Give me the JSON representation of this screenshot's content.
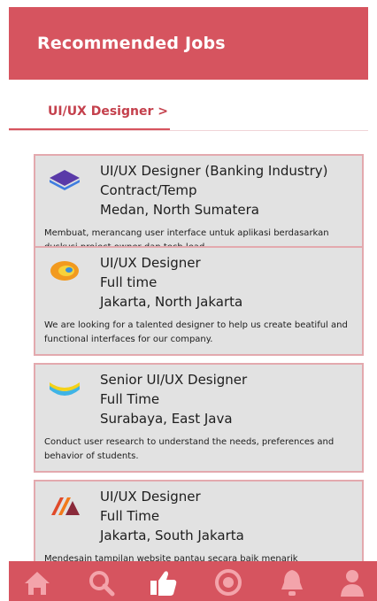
{
  "header": {
    "title": "Recommended Jobs"
  },
  "tab": {
    "label": "UI/UX Designer >"
  },
  "jobs": [
    {
      "title": "UI/UX Designer (Banking Industry)",
      "type": "Contract/Temp",
      "location": "Medan, North Sumatera",
      "description": "Membuat, merancang user interface untuk aplikasi berdasarkan duskusi project owner dan tech lead",
      "logo": "purple-blue-shape-logo"
    },
    {
      "title": "UI/UX Designer",
      "type": "Full time",
      "location": "Jakarta, North Jakarta",
      "description": "We are looking for a talented designer to help us create beatiful and functional interfaces for our company.",
      "logo": "orange-yellow-ring-logo"
    },
    {
      "title": "Senior UI/UX Designer",
      "type": "Full Time",
      "location": "Surabaya, East Java",
      "description": "Conduct user research to understand the needs, preferences and behavior of students.",
      "logo": "yellow-blue-wave-logo"
    },
    {
      "title": "UI/UX Designer",
      "type": "Full Time",
      "location": "Jakarta, South Jakarta",
      "description": "Mendesain tampilan website pantau secara baik menarik",
      "logo": "red-orange-stripes-logo"
    }
  ],
  "nav": {
    "items": [
      "home-icon",
      "search-icon",
      "thumbs-up-icon",
      "badge-icon",
      "bell-icon",
      "profile-icon"
    ]
  },
  "colors": {
    "accent": "#d6545f",
    "card": "#e2e2e2",
    "card_border": "#e3a9ae"
  }
}
